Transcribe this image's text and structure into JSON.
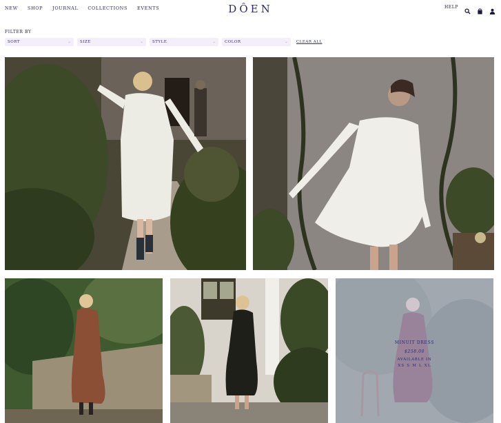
{
  "header": {
    "nav": [
      "NEW",
      "SHOP",
      "JOURNAL",
      "COLLECTIONS",
      "EVENTS"
    ],
    "logo": "DÔEN",
    "help": "HELP",
    "icons": [
      "search-icon",
      "bag-icon",
      "account-icon"
    ]
  },
  "filters": {
    "label": "FILTER BY",
    "selects": [
      "SORT",
      "SIZE",
      "STYLE",
      "COLOR"
    ],
    "clear_all": "CLEAR ALL"
  },
  "products": [
    {
      "overlay": false
    },
    {
      "overlay": false
    },
    {
      "overlay": false
    },
    {
      "overlay": false
    },
    {
      "overlay": true,
      "name": "MINUIT DRESS",
      "price": "$258.00",
      "available_label": "AVAILABLE IN",
      "sizes": "XS  S  M  L  XL"
    }
  ],
  "colors": {
    "brand_navy": "#2b2b6e",
    "select_bg": "#f4eefb",
    "overlay": "#bebeeb"
  }
}
